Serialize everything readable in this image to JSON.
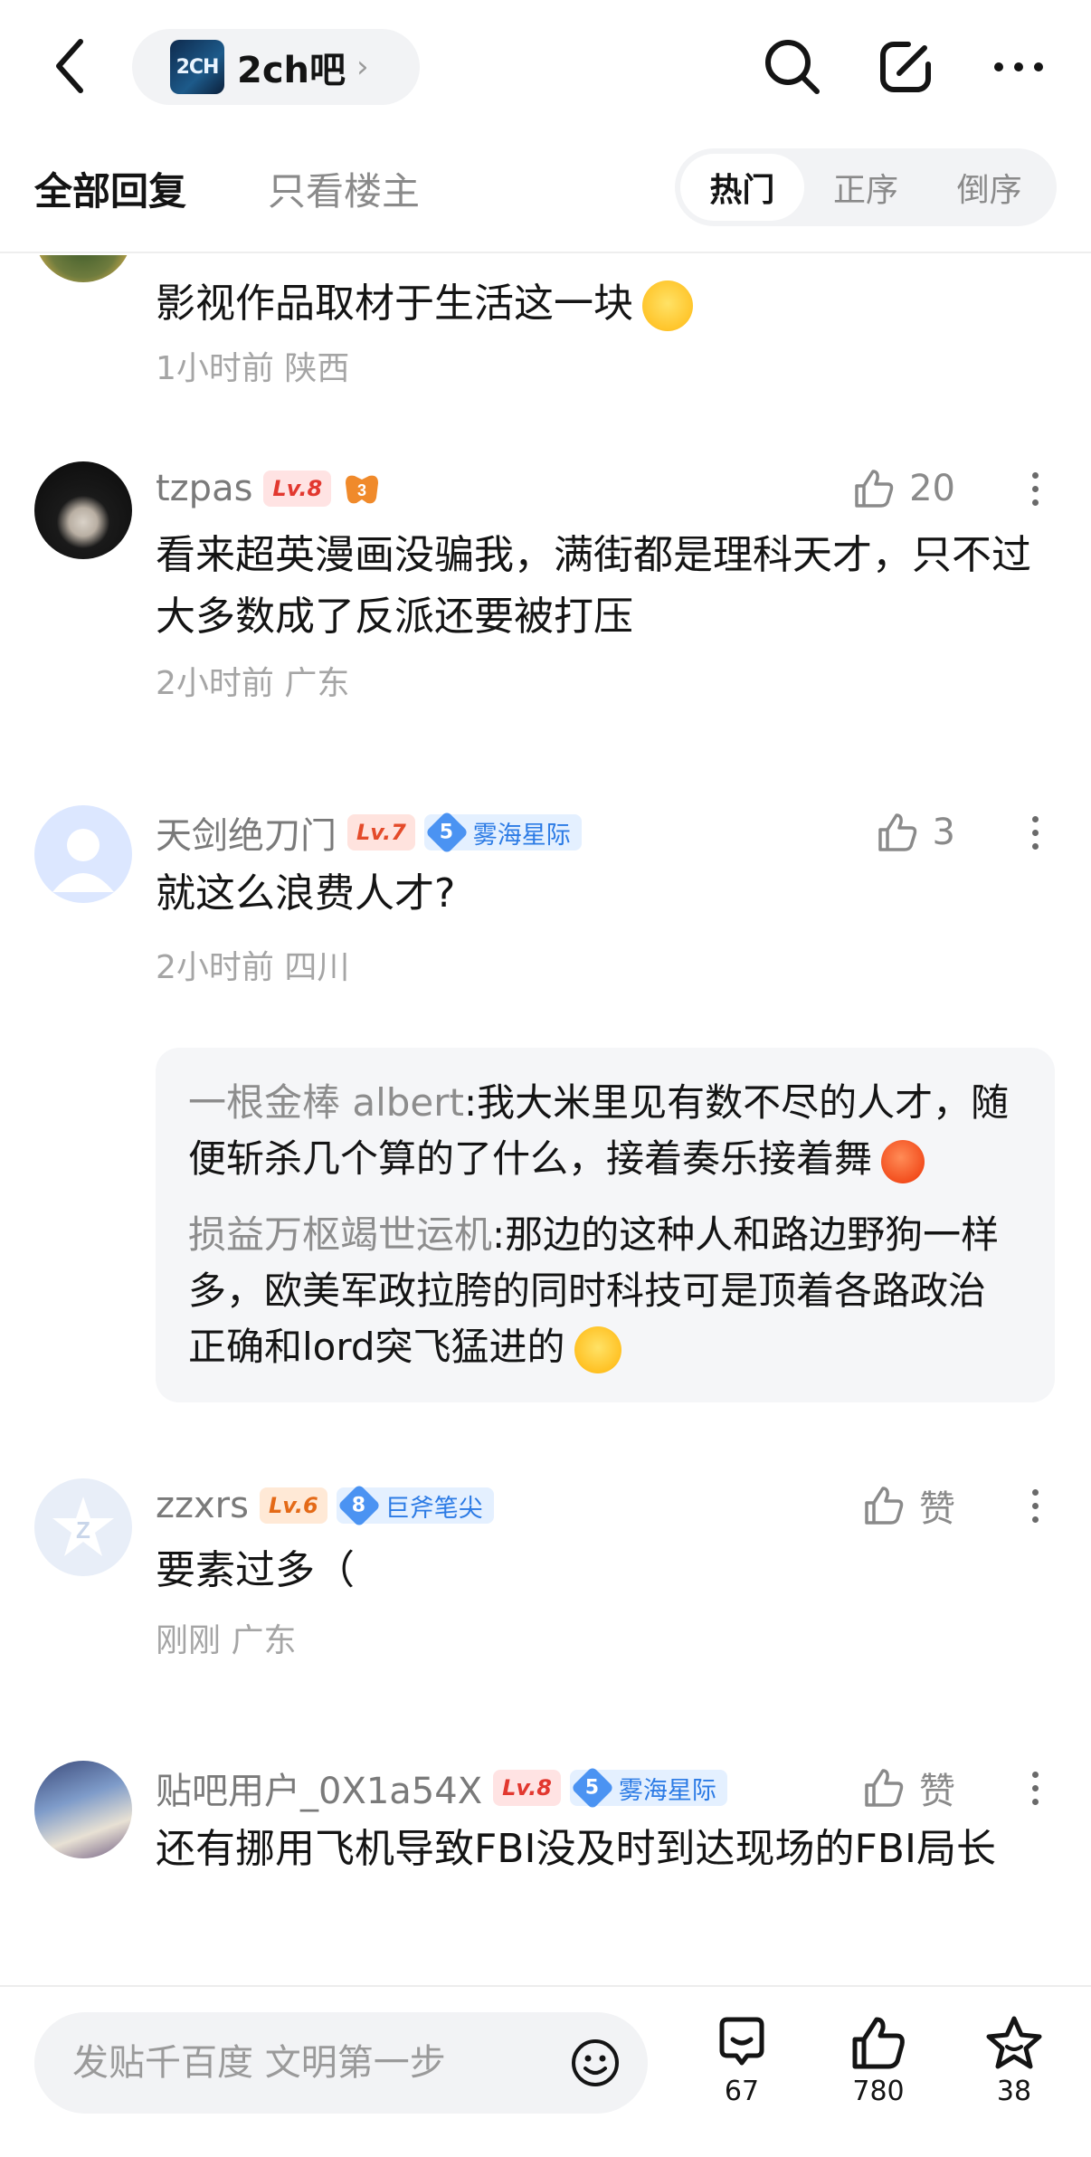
{
  "header": {
    "back_icon": "chevron-left-icon",
    "forum_logo_text": "2CH",
    "forum_name": "2ch吧",
    "search_icon": "search-icon",
    "edit_icon": "edit-icon",
    "more_icon": "more-icon"
  },
  "tabs": {
    "all": "全部回复",
    "op_only": "只看楼主",
    "sort": [
      "热门",
      "正序",
      "倒序"
    ],
    "sort_active": "热门"
  },
  "posts": [
    {
      "content": "影视作品取材于生活这一块",
      "time": "1小时前",
      "location": "陕西"
    },
    {
      "username": "tzpas",
      "level": "Lv.8",
      "likes": "20",
      "content": "看来超英漫画没骗我，满街都是理科天才，只不过大多数成了反派还要被打压",
      "time": "2小时前",
      "location": "广东"
    },
    {
      "username": "天剑绝刀门",
      "level": "Lv.7",
      "badge_num": "5",
      "badge_name": "雾海星际",
      "likes": "3",
      "content": "就这么浪费人才?",
      "time": "2小时前",
      "location": "四川",
      "replies": [
        {
          "user": "一根金棒 albert",
          "sep": ":",
          "text": "我大米里见有数不尽的人才，随便斩杀几个算的了什么，接着奏乐接着舞"
        },
        {
          "user": "损益万枢竭世运机",
          "sep": ":",
          "text": "那边的这种人和路边野狗一样多，欧美军政拉胯的同时科技可是顶着各路政治正确和lord突飞猛进的"
        }
      ]
    },
    {
      "username": "zzxrs",
      "level": "Lv.6",
      "badge_num": "8",
      "badge_name": "巨斧笔尖",
      "likes": "赞",
      "content": "要素过多（",
      "time": "刚刚",
      "location": "广东"
    },
    {
      "username": "贴吧用户_0X1a54X",
      "level": "Lv.8",
      "badge_num": "5",
      "badge_name": "雾海星际",
      "likes": "赞",
      "content": "还有挪用飞机导致FBI没及时到达现场的FBI局长"
    }
  ],
  "bottom": {
    "placeholder": "发贴千百度 文明第一步",
    "comments": "67",
    "likes": "780",
    "favorites": "38"
  }
}
